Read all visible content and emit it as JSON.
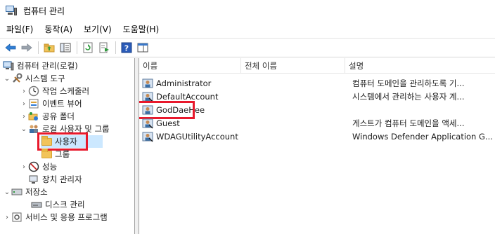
{
  "window": {
    "title": "컴퓨터 관리"
  },
  "menu": [
    "파일(F)",
    "동작(A)",
    "보기(V)",
    "도움말(H)"
  ],
  "tree": {
    "root": "컴퓨터 관리(로컬)",
    "system_tools": "시스템 도구",
    "task_scheduler": "작업 스케줄러",
    "event_viewer": "이벤트 뷰어",
    "shared_folders": "공유 폴더",
    "local_users_groups": "로컬 사용자 및 그룹",
    "users": "사용자",
    "groups": "그룹",
    "performance": "성능",
    "device_manager": "장치 관리자",
    "storage": "저장소",
    "disk_management": "디스크 관리",
    "services_apps": "서비스 및 응용 프로그램"
  },
  "list": {
    "columns": [
      "이름",
      "전체 이름",
      "설명"
    ],
    "rows": [
      {
        "name": "Administrator",
        "full_name": "",
        "description": "컴퓨터 도메인을 관리하도록 기..."
      },
      {
        "name": "DefaultAccount",
        "full_name": "",
        "description": "시스템에서 관리하는 사용자 계..."
      },
      {
        "name": "GodDaeHee",
        "full_name": "",
        "description": ""
      },
      {
        "name": "Guest",
        "full_name": "",
        "description": "게스트가 컴퓨터 도메인을 액세..."
      },
      {
        "name": "WDAGUtilityAccount",
        "full_name": "",
        "description": "Windows Defender Application G..."
      }
    ]
  },
  "colors": {
    "highlight": "#e8192c",
    "selected_bg": "#cce8ff",
    "accent": "#3a6ea5"
  }
}
